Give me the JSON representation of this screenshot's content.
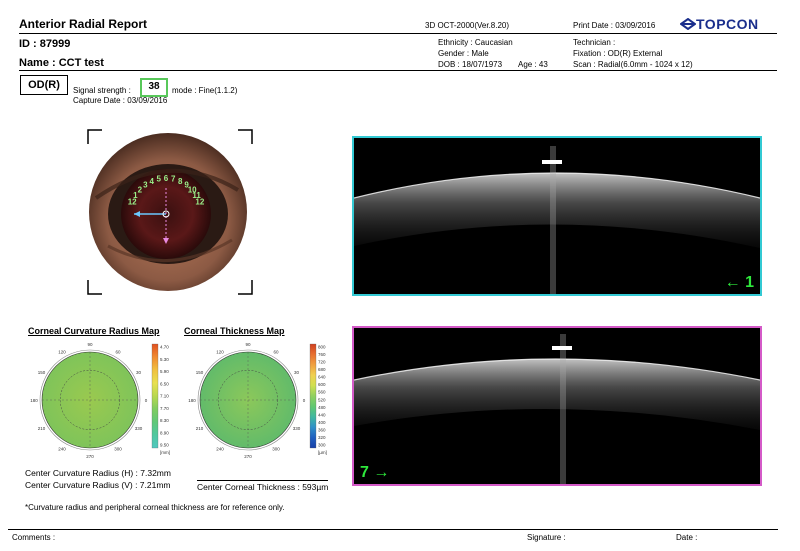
{
  "header": {
    "title": "Anterior Radial Report",
    "device": "3D OCT-2000(Ver.8.20)",
    "print_date": "Print Date : 03/09/2016",
    "logo": "TOPCON",
    "id": "ID : 87999",
    "name": "Name : CCT test",
    "ethnicity": "Ethnicity : Caucasian",
    "gender": "Gender : Male",
    "dob": "DOB : 18/07/1973",
    "age": "Age : 43",
    "technician": "Technician :",
    "fixation": "Fixation : OD(R) External",
    "scan": "Scan : Radial(6.0mm - 1024 x 12)"
  },
  "eye_side": "OD(R)",
  "signal": {
    "label": "Signal strength :",
    "value": "38",
    "mode": "mode : Fine(1.1.2)",
    "capture": "Capture Date : 03/09/2016"
  },
  "fundus": {
    "clock_numbers": [
      "12",
      "1",
      "2",
      "3",
      "4",
      "5",
      "6",
      "7",
      "8",
      "9",
      "10",
      "11",
      "12"
    ],
    "scan_line_labels": [
      "1",
      "7"
    ]
  },
  "oct_scans": [
    {
      "label": "1",
      "arrow": "←",
      "border_color": "#33c9d3"
    },
    {
      "label": "7",
      "arrow": "→",
      "border_color": "#d45ac8"
    }
  ],
  "maps": {
    "curvature": {
      "title": "Corneal Curvature Radius Map",
      "angles": [
        "90",
        "120",
        "60",
        "150",
        "30",
        "180",
        "0",
        "210",
        "330",
        "240",
        "300",
        "270"
      ],
      "scale": [
        "4.70",
        "5.30",
        "5.90",
        "6.50",
        "7.10",
        "7.70",
        "8.30",
        "8.90",
        "9.50"
      ],
      "unit": "[mm]",
      "fill_color": "#9ac94f"
    },
    "thickness": {
      "title": "Corneal Thickness Map",
      "angles": [
        "90",
        "120",
        "60",
        "150",
        "30",
        "180",
        "0",
        "210",
        "330",
        "240",
        "300",
        "270"
      ],
      "scale": [
        "800",
        "760",
        "720",
        "680",
        "640",
        "600",
        "560",
        "520",
        "480",
        "440",
        "400",
        "360",
        "320",
        "300"
      ],
      "unit": "[µm]",
      "fill_color": "#8cc85a"
    }
  },
  "results": {
    "curv_h": "Center Curvature Radius (H) : 7.32mm",
    "curv_v": "Center Curvature Radius (V) : 7.21mm",
    "thickness": "Center Corneal Thickness : 593µm"
  },
  "footnote": "*Curvature radius and peripheral corneal thickness are for reference only.",
  "footer": {
    "comments": "Comments :",
    "signature": "Signature :",
    "date": "Date :"
  }
}
